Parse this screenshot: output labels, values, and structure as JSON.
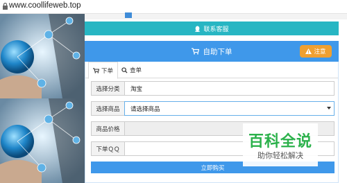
{
  "browser": {
    "url": "www.coollifeweb.top"
  },
  "contact_button": {
    "label": "联系客服",
    "icon": "qq-icon"
  },
  "panel": {
    "title": "自助下单",
    "title_icon": "cart-icon",
    "notice_label": "注意",
    "notice_icon": "warning-icon"
  },
  "tabs": [
    {
      "label": "下单",
      "icon": "cart-icon",
      "active": true
    },
    {
      "label": "查单",
      "icon": "search-icon",
      "active": false
    }
  ],
  "form": {
    "category": {
      "label": "选择分类",
      "value": "淘宝"
    },
    "product": {
      "label": "选择商品",
      "value": "请选择商品"
    },
    "price": {
      "label": "商品价格",
      "value": ""
    },
    "qq": {
      "label": "下单ＱＱ",
      "value": ""
    }
  },
  "buy_button": {
    "label": "立即购买"
  },
  "watermark": {
    "line1": "百科全说",
    "line2": "助你轻松解决"
  },
  "colors": {
    "accent": "#3f98ea",
    "teal": "#27b6c3",
    "orange": "#f0a030",
    "watermark_green": "#2bb14b"
  }
}
